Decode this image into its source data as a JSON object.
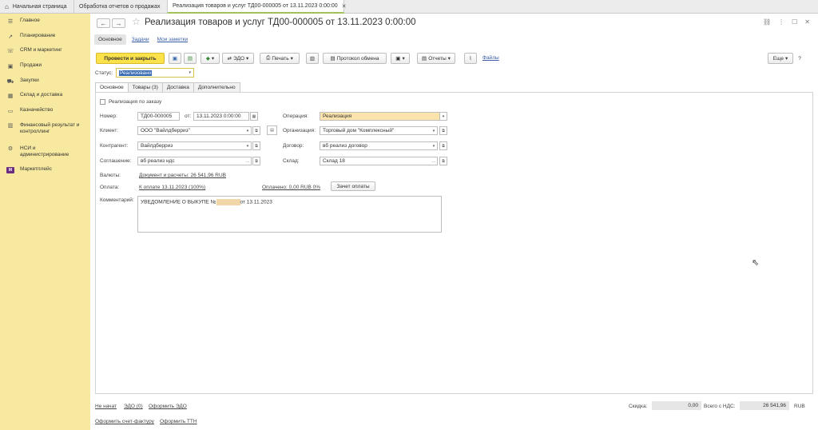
{
  "tabs": [
    {
      "label": "Начальная страница"
    },
    {
      "label": "Обработка отчетов о продажах"
    },
    {
      "label": "Реализация товаров и услуг ТД00-000005 от 13.11.2023 0:00:00"
    }
  ],
  "sidebar": {
    "items": [
      {
        "label": "Главное",
        "icon": "menu-icon"
      },
      {
        "label": "Планирование",
        "icon": "chart-icon"
      },
      {
        "label": "CRM и маркетинг",
        "icon": "phone-icon"
      },
      {
        "label": "Продажи",
        "icon": "briefcase-icon"
      },
      {
        "label": "Закупки",
        "icon": "cart-icon"
      },
      {
        "label": "Склад и доставка",
        "icon": "warehouse-icon"
      },
      {
        "label": "Казначейство",
        "icon": "wallet-icon"
      },
      {
        "label": "Финансовый результат и контроллинг",
        "icon": "finance-icon"
      },
      {
        "label": "НСИ и администрирование",
        "icon": "gear-icon"
      },
      {
        "label": "Маркетплейс",
        "icon": "marketplace-icon",
        "icon_text": "M"
      }
    ]
  },
  "document": {
    "title": "Реализация товаров и услуг ТД00-000005 от 13.11.2023 0:00:00",
    "subtabs": [
      "Основное",
      "Задачи",
      "Мои заметки"
    ]
  },
  "toolbar": {
    "post_close": "Провести и закрыть",
    "edo": "ЭДО",
    "print": "Печать",
    "exchange": "Протокол обмена",
    "reports": "Отчеты",
    "files": "Файлы",
    "more": "Еще"
  },
  "status": {
    "label": "Статус:",
    "value": "Реализовано"
  },
  "formtabs": [
    "Основное",
    "Товары (3)",
    "Доставка",
    "Дополнительно"
  ],
  "form": {
    "by_order": "Реализация по заказу",
    "number_label": "Номер:",
    "number": "ТД00-000005",
    "from_label": "от:",
    "date": "13.11.2023  0:00:00",
    "client_label": "Клиент:",
    "client": "ООО \"Вайлдберриз\"",
    "counterparty_label": "Контрагент:",
    "counterparty": "Вайлдберриз",
    "agreement_label": "Соглашение:",
    "agreement": "вб реализ ндс",
    "operation_label": "Операция:",
    "operation": "Реализация",
    "org_label": "Организация:",
    "org": "Торговый дом \"Комплексный\"",
    "contract_label": "Договор:",
    "contract": "вб реализ договор",
    "warehouse_label": "Склад:",
    "warehouse": "Склад 18",
    "currency_label": "Валюты:",
    "currency_link": "Документ и расчеты: 26 541,96 RUB",
    "payment_label": "Оплата:",
    "payment_link": "К оплате 13.11.2023 (100%)",
    "paid_link": "Оплачено: 0,00 RUB 0%",
    "offset_button": "Зачет оплаты",
    "comment_label": "Комментарий:",
    "comment_prefix": "УВЕДОМЛЕНИЕ О ВЫКУПЕ №",
    "comment_suffix": "от 13.11.2023"
  },
  "footer": {
    "not_started": "Не начат",
    "edi": "ЭДО (0)",
    "issue_edi": "Оформить ЭДО",
    "invoice": "Оформить счет-фактуру",
    "ttn": "Оформить ТТН",
    "discount_label": "Скидка:",
    "discount": "0,00",
    "total_label": "Всего с НДС:",
    "total": "26 541,96",
    "currency": "RUB"
  }
}
